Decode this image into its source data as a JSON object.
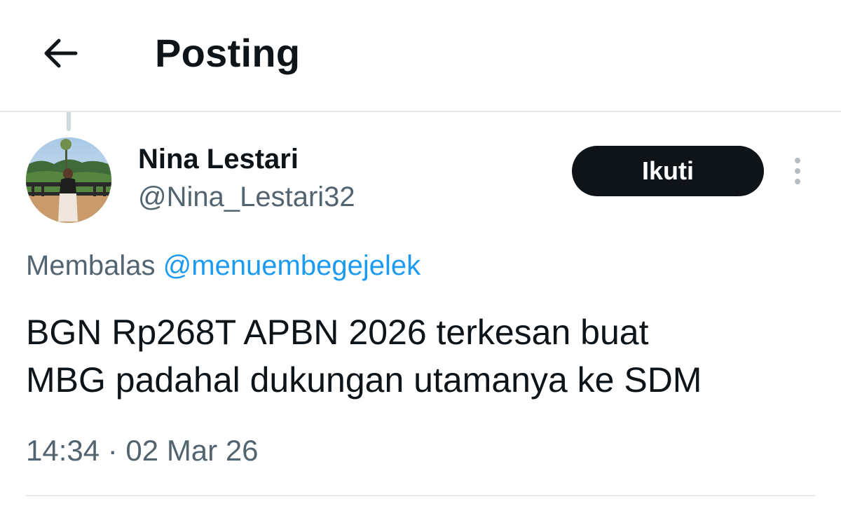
{
  "header": {
    "title": "Posting",
    "back_icon": "arrow-left-icon"
  },
  "post": {
    "author": {
      "name": "Nina Lestari",
      "handle": "@Nina_Lestari32",
      "avatar": "user-photo"
    },
    "follow_label": "Ikuti",
    "more_icon": "vertical-dots-icon",
    "reply_prefix": "Membalas",
    "reply_to": "@menuembegejelek",
    "text_line1": "BGN Rp268T APBN 2026 terkesan buat",
    "text_line2": "MBG padahal dukungan utamanya ke SDM",
    "timestamp": "14:34 · 02 Mar 26"
  },
  "colors": {
    "text_primary": "#0f1419",
    "text_secondary": "#536471",
    "accent": "#1d9bf0",
    "divider": "#e3e8ec"
  }
}
